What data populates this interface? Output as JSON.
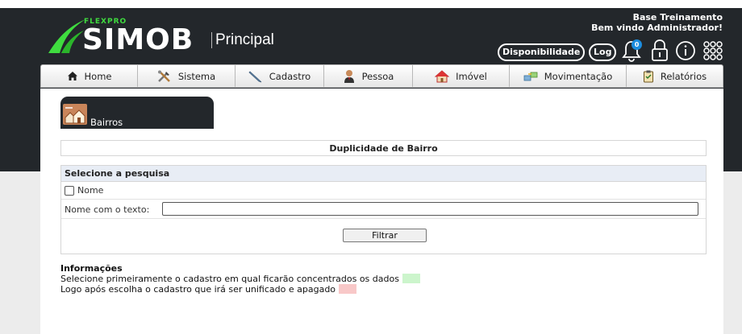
{
  "brand": {
    "flexpro": "FLEXPRO",
    "simob": "SIMOB",
    "principal": "Principal"
  },
  "user": {
    "base": "Base Treinamento",
    "welcome": "Bem vindo Administrador!"
  },
  "header": {
    "disponibilidade": "Disponibilidade",
    "log": "Log",
    "notification_count": "0"
  },
  "nav": {
    "items": [
      {
        "label": "Home",
        "icon": "home-icon"
      },
      {
        "label": "Sistema",
        "icon": "tools-icon"
      },
      {
        "label": "Cadastro",
        "icon": "pen-icon"
      },
      {
        "label": "Pessoa",
        "icon": "person-icon"
      },
      {
        "label": "Imóvel",
        "icon": "house-icon"
      },
      {
        "label": "Movimentação",
        "icon": "transfer-icon"
      },
      {
        "label": "Relatórios",
        "icon": "report-icon"
      }
    ]
  },
  "tab": {
    "label": "Bairros",
    "icon": "neighborhood-icon"
  },
  "page": {
    "title": "Duplicidade de Bairro"
  },
  "search": {
    "header": "Selecione a pesquisa",
    "checkbox_label": "Nome",
    "checkbox_checked": false,
    "text_label": "Nome com o texto:",
    "text_value": "",
    "filter_button": "Filtrar"
  },
  "info": {
    "title": "Informações",
    "line1": "Selecione primeiramente o cadastro em qual ficarão concentrados os dados",
    "line2": "Logo após escolha o cadastro que irá ser unificado e apagado",
    "color_keep": "#ccf5cc",
    "color_delete": "#f8c8c8"
  },
  "colors": {
    "header_bg": "#23272b",
    "brand_green": "#3fdc3f",
    "badge_blue": "#1b8de0"
  }
}
